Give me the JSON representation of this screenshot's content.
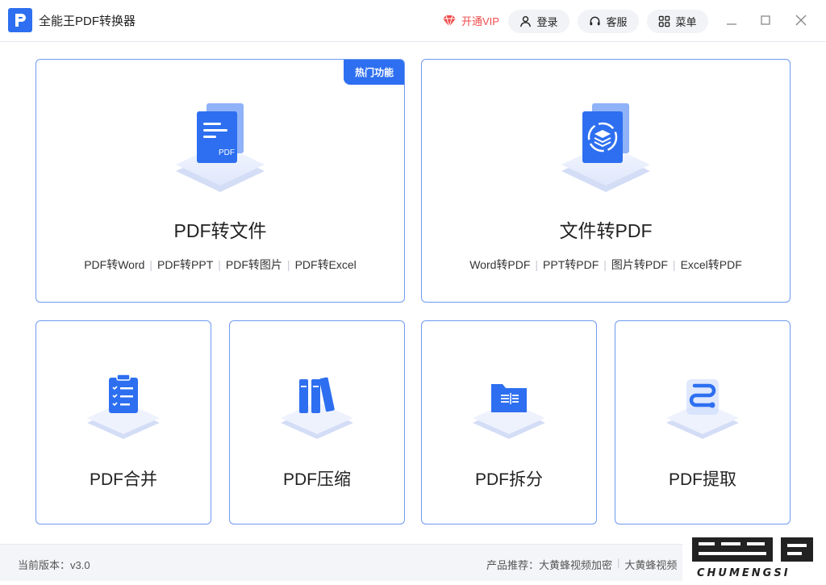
{
  "app": {
    "title": "全能王PDF转换器"
  },
  "header": {
    "vip_label": "开通VIP",
    "login_label": "登录",
    "service_label": "客服",
    "menu_label": "菜单"
  },
  "cards": {
    "pdf_to_file": {
      "badge": "热门功能",
      "title": "PDF转文件",
      "subs": [
        "PDF转Word",
        "PDF转PPT",
        "PDF转图片",
        "PDF转Excel"
      ]
    },
    "file_to_pdf": {
      "title": "文件转PDF",
      "subs": [
        "Word转PDF",
        "PPT转PDF",
        "图片转PDF",
        "Excel转PDF"
      ]
    },
    "merge": {
      "title": "PDF合并"
    },
    "compress": {
      "title": "PDF压缩"
    },
    "split": {
      "title": "PDF拆分"
    },
    "extract": {
      "title": "PDF提取"
    }
  },
  "footer": {
    "version_label": "当前版本：v3.0",
    "recommend_label": "产品推荐：",
    "recommend_items": [
      "大黄蜂视频加密",
      "大黄蜂视频"
    ]
  },
  "watermark": {
    "text": "CHUMENGSI"
  },
  "colors": {
    "accent": "#2d6ff0",
    "vip": "#f04b4b",
    "card_border": "#6f9af1"
  }
}
